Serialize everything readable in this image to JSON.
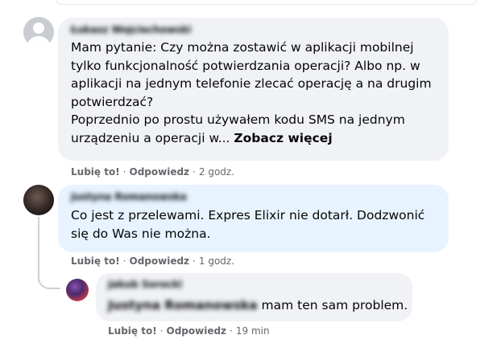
{
  "comments": [
    {
      "author": "Łukasz Wojciechowski",
      "lines": [
        "Mam pytanie: Czy można zostawić w aplikacji mobilnej",
        "tylko funkcjonalność potwierdzania operacji? Albo np. w",
        "aplikacji na jednym telefonie zlecać operację a na drugim",
        "potwierdzać?",
        "Poprzednio po prostu używałem kodu SMS na jednym",
        "urządzeniu a operacji w..."
      ],
      "see_more": "Zobacz więcej",
      "like": "Lubię to!",
      "reply": "Odpowiedz",
      "time": "2 godz."
    },
    {
      "author": "Justyna Romanowska",
      "lines": [
        "Co jest z przelewami. Expres Elixir nie dotarł. Dodzwonić",
        "się do Was nie można."
      ],
      "like": "Lubię to!",
      "reply": "Odpowiedz",
      "time": "1 godz."
    },
    {
      "author": "Jakub Sorocki",
      "mention": "Justyna Romanowska",
      "text": " mam ten sam problem.",
      "like": "Lubię to!",
      "reply": "Odpowiedz",
      "time": "19 min"
    }
  ],
  "separator": "·"
}
